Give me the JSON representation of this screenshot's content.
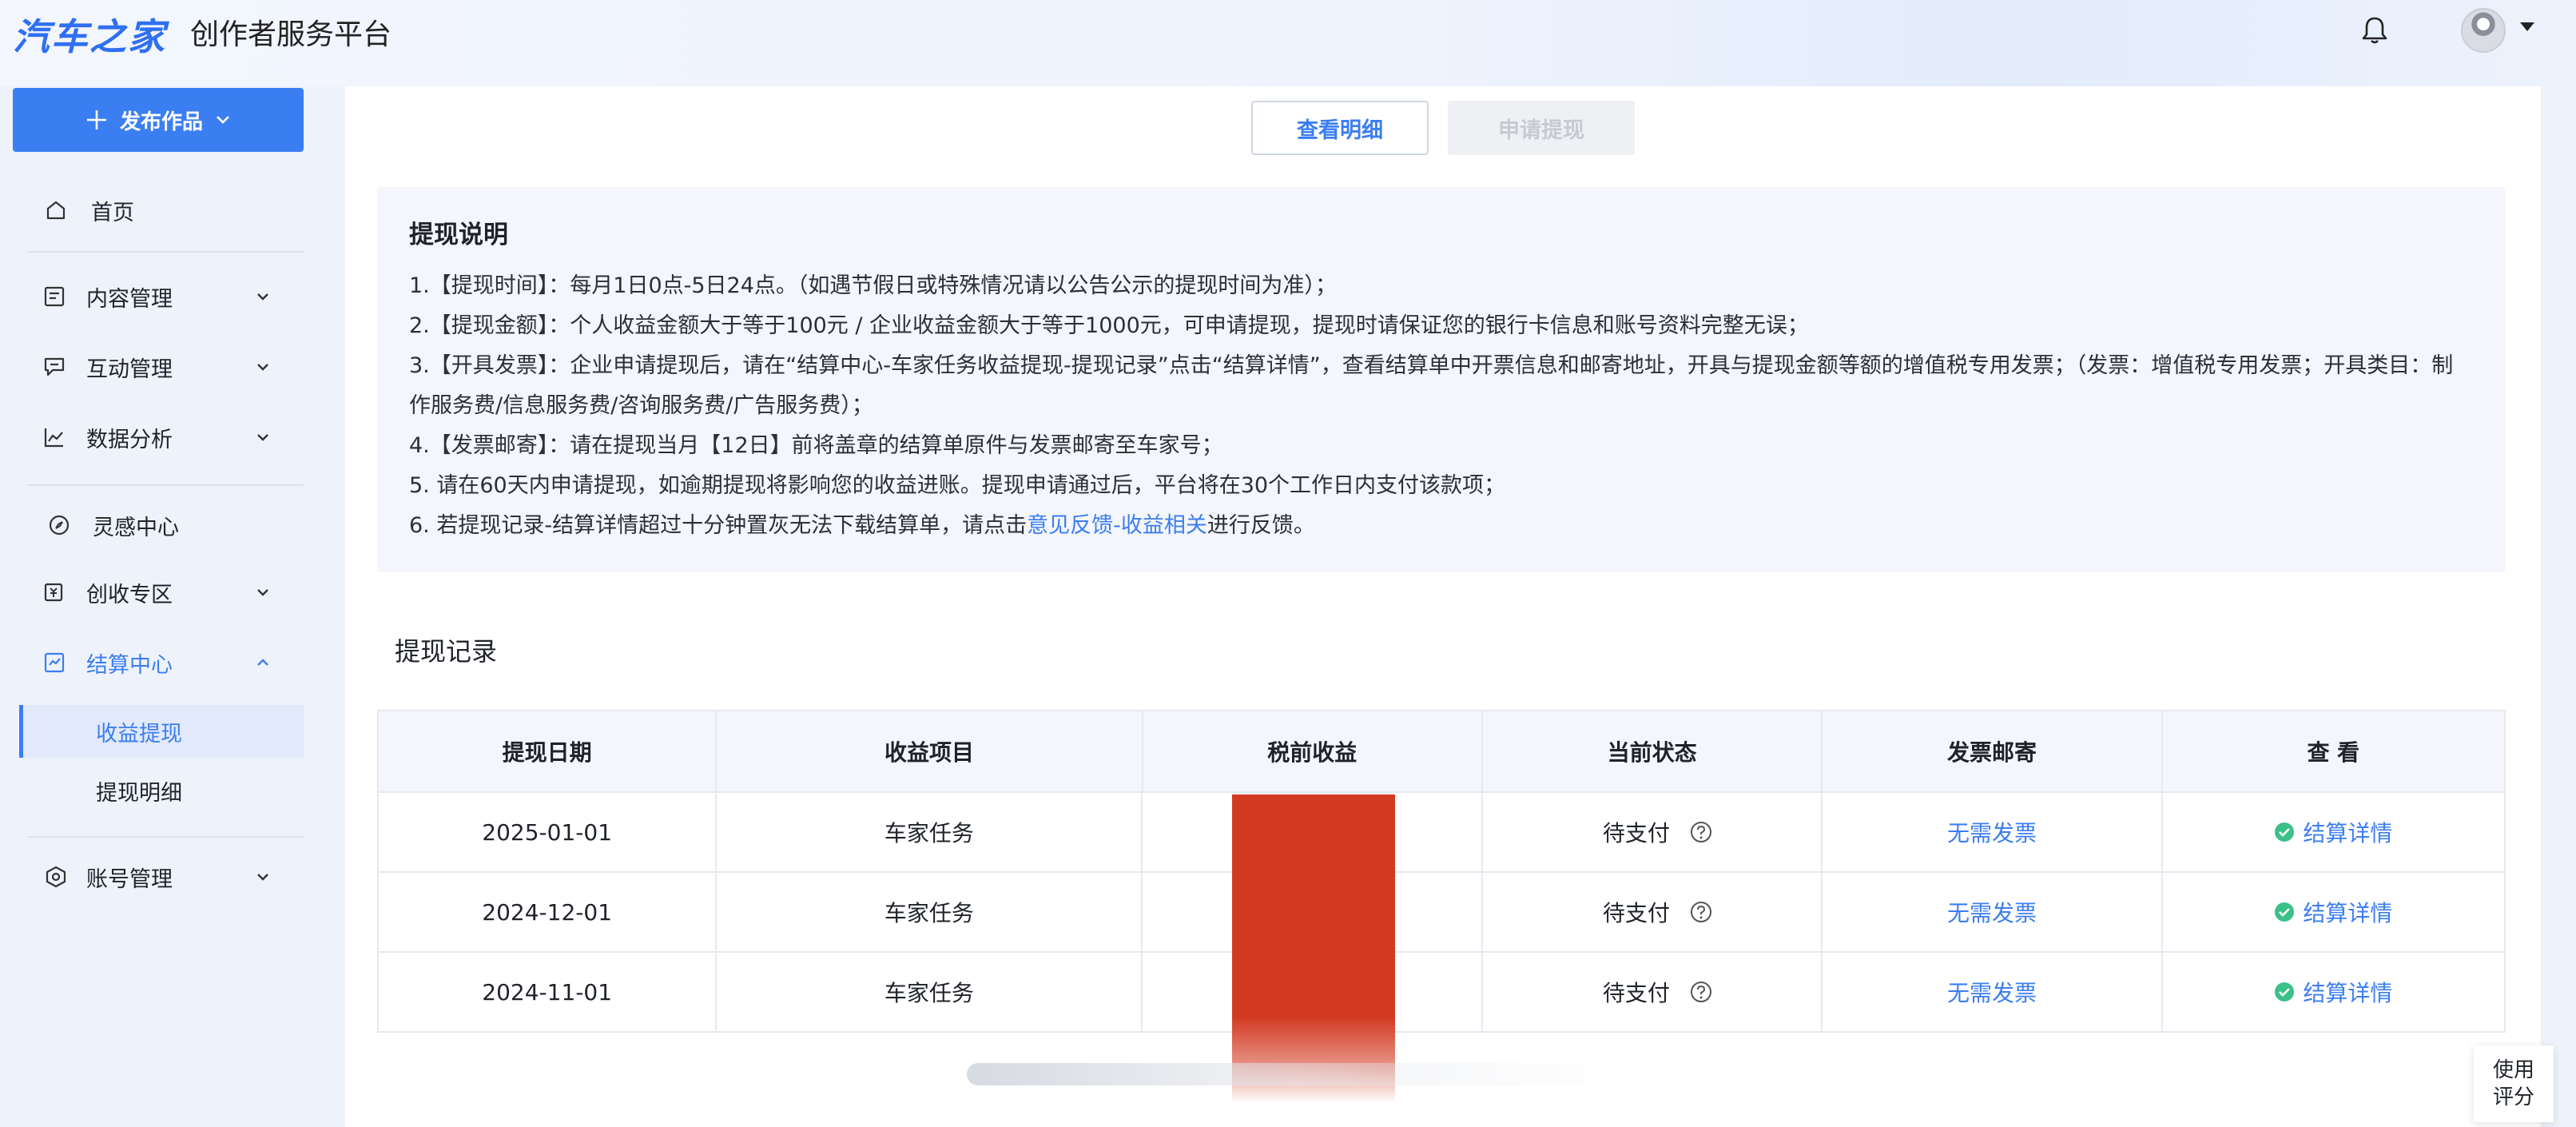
{
  "header": {
    "logo": "汽车之家",
    "platform_title": "创作者服务平台",
    "icons": [
      "bell-icon",
      "avatar"
    ]
  },
  "sidebar": {
    "publish_label": "发布作品",
    "items": [
      {
        "label": "首页",
        "icon": "home-icon"
      },
      {
        "label": "内容管理",
        "icon": "document-icon"
      },
      {
        "label": "互动管理",
        "icon": "chat-icon"
      },
      {
        "label": "数据分析",
        "icon": "chart-icon"
      },
      {
        "label": "灵感中心",
        "icon": "compass-icon"
      },
      {
        "label": "创收专区",
        "icon": "money-icon"
      },
      {
        "label": "结算中心",
        "icon": "settlement-icon"
      },
      {
        "label": "账号管理",
        "icon": "account-icon"
      }
    ],
    "sub_items": [
      {
        "label": "收益提现",
        "selected": true
      },
      {
        "label": "提现明细",
        "selected": false
      }
    ]
  },
  "actions": {
    "view_detail": "查看明细",
    "apply_withdraw": "申请提现"
  },
  "notice": {
    "title": "提现说明",
    "lines": [
      "1.【提现时间】：每月1日0点-5日24点。（如遇节假日或特殊情况请以公告公示的提现时间为准）；",
      "2.【提现金额】：个人收益金额大于等于100元 / 企业收益金额大于等于1000元，可申请提现，提现时请保证您的银行卡信息和账号资料完整无误；",
      "3.【开具发票】：企业申请提现后，请在“结算中心-车家任务收益提现-提现记录”点击“结算详情”，查看结算单中开票信息和邮寄地址，开具与提现金额等额的增值税专用发票；（发票：增值税专用发票；开具类目：制作服务费/信息服务费/咨询服务费/广告服务费）；",
      "4.【发票邮寄】：请在提现当月【12日】前将盖章的结算单原件与发票邮寄至车家号；",
      "5. 请在60天内申请提现，如逾期提现将影响您的收益进账。提现申请通过后，平台将在30个工作日内支付该款项；"
    ],
    "line6_prefix": "6. 若提现记录-结算详情超过十分钟置灰无法下载结算单，请点击",
    "line6_link": "意见反馈-收益相关",
    "line6_suffix": "进行反馈。"
  },
  "records": {
    "title": "提现记录",
    "columns": [
      "提现日期",
      "收益项目",
      "税前收益",
      "当前状态",
      "发票邮寄",
      "查 看"
    ],
    "rows": [
      {
        "date": "2025-01-01",
        "project": "车家任务",
        "status": "待支付",
        "invoice": "无需发票",
        "detail": "结算详情"
      },
      {
        "date": "2024-12-01",
        "project": "车家任务",
        "status": "待支付",
        "invoice": "无需发票",
        "detail": "结算详情"
      },
      {
        "date": "2024-11-01",
        "project": "车家任务",
        "status": "待支付",
        "invoice": "无需发票",
        "detail": "结算详情"
      }
    ]
  },
  "feedback": {
    "line1": "使用",
    "line2": "评分"
  },
  "colors": {
    "accent": "#3b7ef2",
    "redaction": "#d33a22",
    "success": "#3cc08a"
  }
}
